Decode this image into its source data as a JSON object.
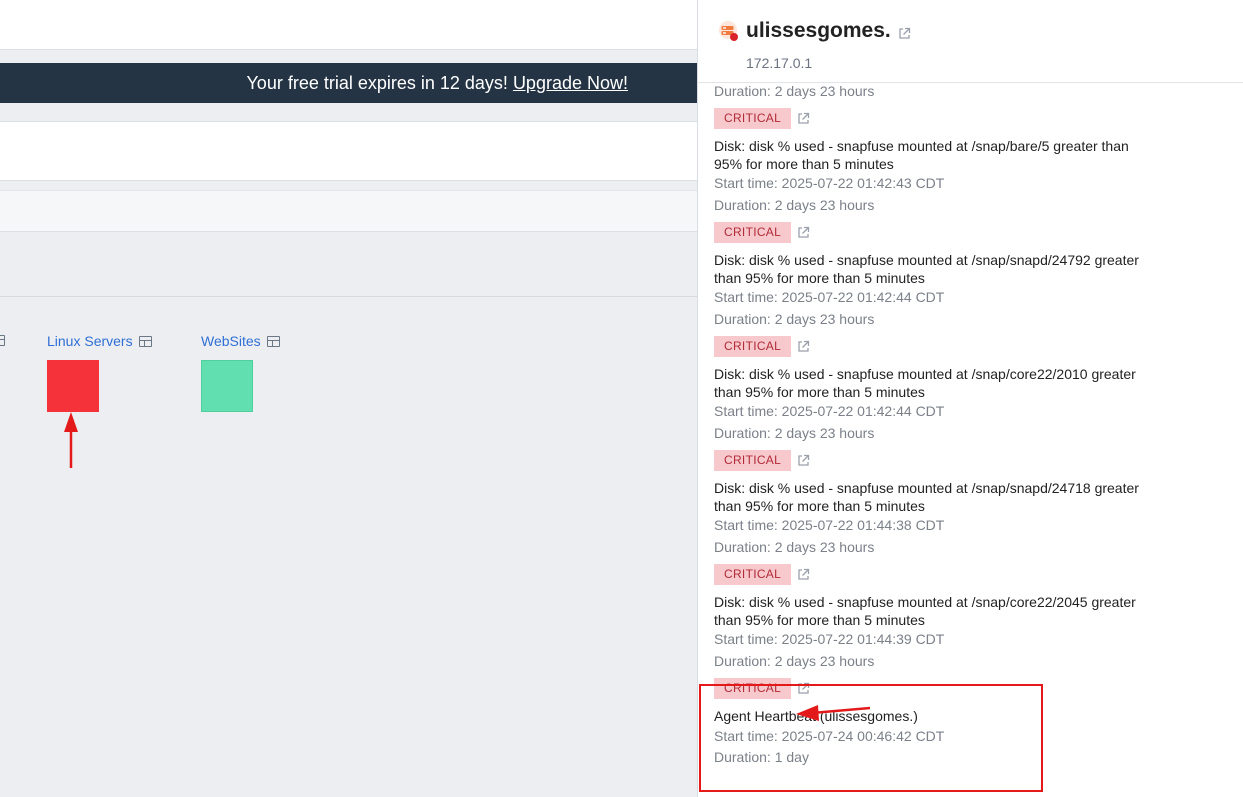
{
  "banner": {
    "text": "Your free trial expires in 12 days!",
    "link": "Upgrade Now!"
  },
  "groups": [
    {
      "label": "Linux Servers",
      "status_color": "#f5313a"
    },
    {
      "label": "WebSites",
      "status_color": "#62dfb0"
    }
  ],
  "panel": {
    "host_name": "ulissesgomes.",
    "host_ip": "172.17.0.1",
    "top_duration": "Duration: 2 days 23 hours",
    "alerts": [
      {
        "severity": "CRITICAL",
        "title": "Disk: disk % used - snapfuse mounted at /snap/bare/5 greater than 95% for more than 5 minutes",
        "start": "Start time: 2025-07-22 01:42:43 CDT",
        "duration": "Duration: 2 days 23 hours"
      },
      {
        "severity": "CRITICAL",
        "title": "Disk: disk % used - snapfuse mounted at /snap/snapd/24792 greater than 95% for more than 5 minutes",
        "start": "Start time: 2025-07-22 01:42:44 CDT",
        "duration": "Duration: 2 days 23 hours"
      },
      {
        "severity": "CRITICAL",
        "title": "Disk: disk % used - snapfuse mounted at /snap/core22/2010 greater than 95% for more than 5 minutes",
        "start": "Start time: 2025-07-22 01:42:44 CDT",
        "duration": "Duration: 2 days 23 hours"
      },
      {
        "severity": "CRITICAL",
        "title": "Disk: disk % used - snapfuse mounted at /snap/snapd/24718 greater than 95% for more than 5 minutes",
        "start": "Start time: 2025-07-22 01:44:38 CDT",
        "duration": "Duration: 2 days 23 hours"
      },
      {
        "severity": "CRITICAL",
        "title": "Disk: disk % used - snapfuse mounted at /snap/core22/2045 greater than 95% for more than 5 minutes",
        "start": "Start time: 2025-07-22 01:44:39 CDT",
        "duration": "Duration: 2 days 23 hours"
      },
      {
        "severity": "CRITICAL",
        "title": "Agent Heartbeat (ulissesgomes.)",
        "start": "Start time: 2025-07-24 00:46:42 CDT",
        "duration": "Duration: 1 day"
      }
    ]
  },
  "icons": {
    "grid": "grid-icon",
    "external": "external-link-icon",
    "host": "server-status-icon"
  }
}
